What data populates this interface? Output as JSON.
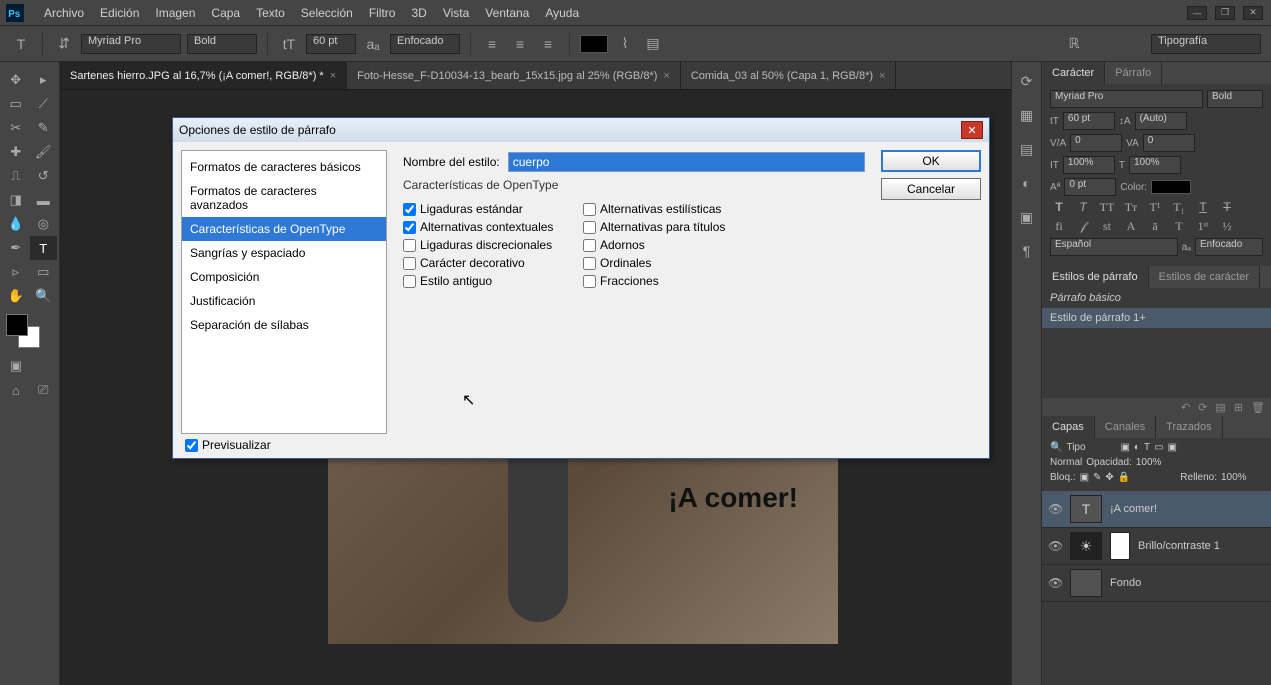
{
  "menubar": {
    "items": [
      "Archivo",
      "Edición",
      "Imagen",
      "Capa",
      "Texto",
      "Selección",
      "Filtro",
      "3D",
      "Vista",
      "Ventana",
      "Ayuda"
    ]
  },
  "optionsbar": {
    "font": "Myriad Pro",
    "weight": "Bold",
    "size": "60 pt",
    "aa": "Enfocado",
    "panel_btn": "Tipografía"
  },
  "doctabs": [
    {
      "label": "Sartenes hierro.JPG al 16,7% (¡A comer!, RGB/8*) *",
      "active": true
    },
    {
      "label": "Foto-Hesse_F-D10034-13_bearb_15x15.jpg al 25% (RGB/8*)",
      "active": false
    },
    {
      "label": "Comida_03 al 50% (Capa 1, RGB/8*)",
      "active": false
    }
  ],
  "canvas_text": "¡A comer!",
  "char_panel": {
    "tabs": [
      "Carácter",
      "Párrafo"
    ],
    "font": "Myriad Pro",
    "weight": "Bold",
    "size": "60 pt",
    "leading": "(Auto)",
    "tracking": "0",
    "kerning": "0",
    "vscale": "100%",
    "hscale": "100%",
    "baseline": "0 pt",
    "color_label": "Color:",
    "lang": "Español",
    "aa": "Enfocado"
  },
  "styles_panel": {
    "tabs": [
      "Estilos de párrafo",
      "Estilos de carácter"
    ],
    "items": [
      "Párrafo básico",
      "Estilo de párrafo 1+"
    ]
  },
  "layers_panel": {
    "tabs": [
      "Capas",
      "Canales",
      "Trazados"
    ],
    "filter": "Tipo",
    "blend": "Normal",
    "opacity_label": "Opacidad:",
    "opacity": "100%",
    "lock_label": "Bloq.:",
    "fill_label": "Relleno:",
    "fill": "100%",
    "layers": [
      {
        "name": "¡A comer!",
        "type": "T",
        "selected": true
      },
      {
        "name": "Brillo/contraste 1",
        "type": "adj"
      },
      {
        "name": "Fondo",
        "type": "bg"
      }
    ]
  },
  "dialog": {
    "title": "Opciones de estilo de párrafo",
    "sidebar": [
      "Formatos de caracteres básicos",
      "Formatos de caracteres avanzados",
      "Características de OpenType",
      "Sangrías y espaciado",
      "Composición",
      "Justificación",
      "Separación de sílabas"
    ],
    "sidebar_selected": 2,
    "stylename_label": "Nombre del estilo:",
    "stylename_value": "cuerpo",
    "section_title": "Características de OpenType",
    "checks_left": [
      {
        "label": "Ligaduras estándar",
        "checked": true
      },
      {
        "label": "Alternativas contextuales",
        "checked": true
      },
      {
        "label": "Ligaduras discrecionales",
        "checked": false
      },
      {
        "label": "Carácter decorativo",
        "checked": false
      },
      {
        "label": "Estilo antiguo",
        "checked": false
      }
    ],
    "checks_right": [
      {
        "label": "Alternativas estilísticas",
        "checked": false
      },
      {
        "label": "Alternativas para títulos",
        "checked": false
      },
      {
        "label": "Adornos",
        "checked": false
      },
      {
        "label": "Ordinales",
        "checked": false
      },
      {
        "label": "Fracciones",
        "checked": false
      }
    ],
    "ok": "OK",
    "cancel": "Cancelar",
    "preview": "Previsualizar"
  }
}
